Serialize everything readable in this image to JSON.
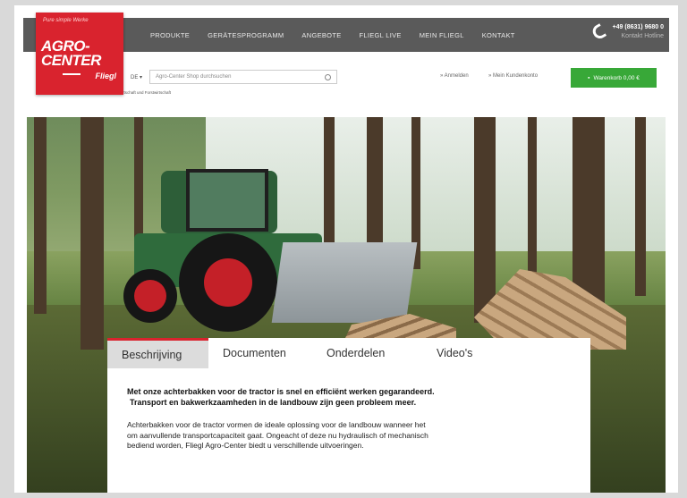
{
  "brand": {
    "tagline": "Pure simple Werke",
    "logo_line1": "AGRO-",
    "logo_line2": "CENTER",
    "logo_sub": "Fliegl"
  },
  "nav": {
    "items": [
      "Produkte",
      "Gerätesprogramm",
      "Angebote",
      "Fliegl Live",
      "Mein Fliegl",
      "Kontakt"
    ]
  },
  "contact": {
    "phone": "+49 (8631) 9680 0",
    "sub": "Kontakt Hotline"
  },
  "search": {
    "language": "DE ▾",
    "placeholder": "Agro-Center Shop durchsuchen"
  },
  "account": {
    "login": "» Anmelden",
    "register": "» Mein Kundenkonto"
  },
  "cart": {
    "label": "Warenkorb 0,00 €"
  },
  "breadcrumb": "Fliegl Agro-Center - Online Shop für Landwirtschaft und Forstwirtschaft",
  "tabs": [
    {
      "label": "Beschrijving"
    },
    {
      "label": "Documenten"
    },
    {
      "label": "Onderdelen"
    },
    {
      "label": "Video's"
    }
  ],
  "content": {
    "lead_line1": "Met onze achterbakken voor de tractor is snel en efficiënt werken gegarandeerd.",
    "lead_line2": "Transport en bakwerkzaamheden in de landbouw zijn geen probleem meer.",
    "body_line1": "Achterbakken voor de tractor vormen de ideale oplossing voor de landbouw wanneer het",
    "body_line2": "om aanvullende transportcapaciteit gaat. Ongeacht of deze nu hydraulisch of mechanisch",
    "body_line3": "bediend worden, Fliegl Agro-Center biedt u verschillende uitvoeringen."
  },
  "colors": {
    "accent": "#d9232e",
    "nav_bg": "#5a5a5a",
    "cart": "#38a838"
  }
}
